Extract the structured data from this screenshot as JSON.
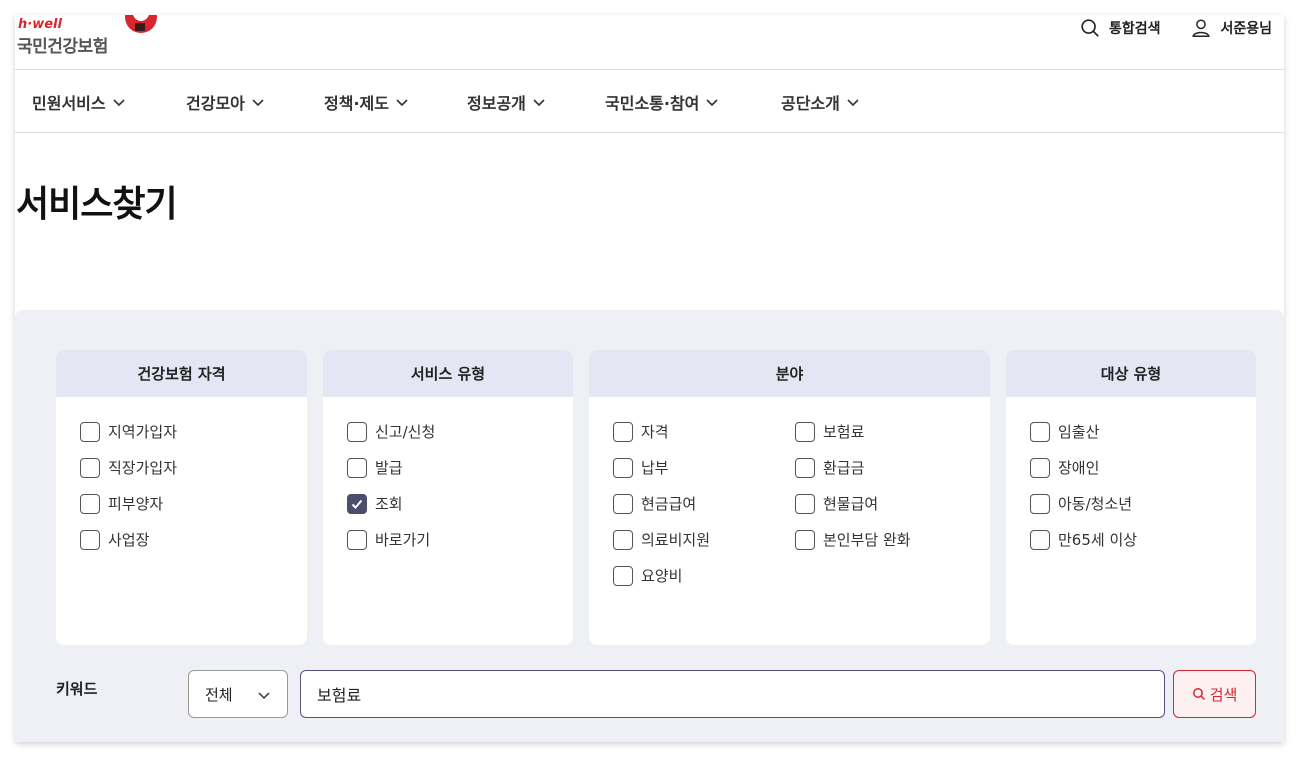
{
  "header": {
    "brand": "h·well",
    "org_name": "국민건강보험",
    "util": {
      "search_label": "통합검색",
      "user_label": "서준용님"
    }
  },
  "gnb": [
    {
      "label": "민원서비스"
    },
    {
      "label": "건강모아"
    },
    {
      "label": "정책·제도"
    },
    {
      "label": "정보공개"
    },
    {
      "label": "국민소통·참여"
    },
    {
      "label": "공단소개"
    }
  ],
  "page_title": "서비스찾기",
  "filters": {
    "qualification": {
      "title": "건강보험 자격",
      "options": [
        {
          "label": "지역가입자",
          "checked": false
        },
        {
          "label": "직장가입자",
          "checked": false
        },
        {
          "label": "피부양자",
          "checked": false
        },
        {
          "label": "사업장",
          "checked": false
        }
      ]
    },
    "service_type": {
      "title": "서비스 유형",
      "options": [
        {
          "label": "신고/신청",
          "checked": false
        },
        {
          "label": "발급",
          "checked": false
        },
        {
          "label": "조회",
          "checked": true
        },
        {
          "label": "바로가기",
          "checked": false
        }
      ]
    },
    "field": {
      "title": "분야",
      "options": [
        {
          "label": "자격",
          "checked": false
        },
        {
          "label": "보험료",
          "checked": false
        },
        {
          "label": "납부",
          "checked": false
        },
        {
          "label": "환급금",
          "checked": false
        },
        {
          "label": "현금급여",
          "checked": false
        },
        {
          "label": "현물급여",
          "checked": false
        },
        {
          "label": "의료비지원",
          "checked": false
        },
        {
          "label": "본인부담 완화",
          "checked": false
        },
        {
          "label": "요양비",
          "checked": false
        }
      ]
    },
    "target_type": {
      "title": "대상 유형",
      "options": [
        {
          "label": "임출산",
          "checked": false
        },
        {
          "label": "장애인",
          "checked": false
        },
        {
          "label": "아동/청소년",
          "checked": false
        },
        {
          "label": "만65세 이상",
          "checked": false
        }
      ]
    }
  },
  "keyword": {
    "label": "키워드",
    "scope_selected": "전체",
    "value": "보험료",
    "search_button": "검색"
  },
  "colors": {
    "accent": "#d8262e",
    "panel_head": "#e4e7f3",
    "filter_bg": "#eef0f6",
    "check": "#4b4e6d"
  }
}
